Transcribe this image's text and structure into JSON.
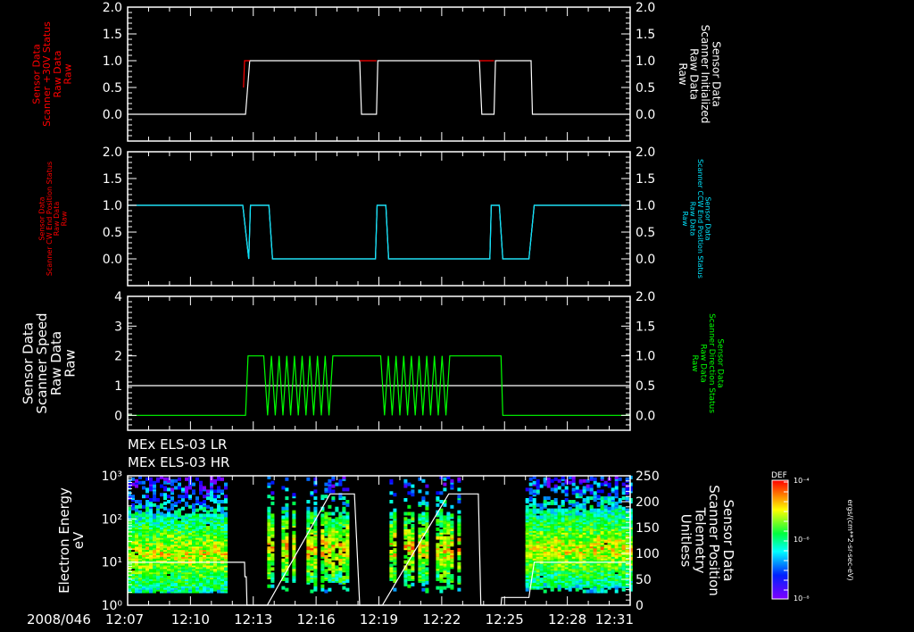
{
  "time_axis": {
    "date_label": "2008/046",
    "ticks": [
      "12:07",
      "12:10",
      "12:13",
      "12:16",
      "12:19",
      "12:22",
      "12:25",
      "12:28",
      "12:31"
    ],
    "range": [
      "12:07:00",
      "12:31:00"
    ]
  },
  "titles": [
    "MEx ELS-03 LR",
    "MEx ELS-03 HR"
  ],
  "colorbar": {
    "title": "DEF",
    "tick_labels": [
      "10⁻⁴",
      "10⁻⁶",
      "10⁻⁸"
    ],
    "unit_label": "ergs/(cm**2-sr-sec-eV)",
    "colormap": "rainbow (violet-blue-cyan-green-yellow-red)"
  },
  "colors": {
    "background": "#000000",
    "axes": "#ffffff",
    "red": "#ff0000",
    "cyan": "#00e5ff",
    "green": "#00ff00",
    "white": "#ffffff"
  },
  "chart_data": [
    {
      "type": "line",
      "left_label": [
        "Sensor Data",
        "Scanner +30V Status",
        "Raw Data",
        "Raw"
      ],
      "left_label_color": "#ff0000",
      "right_label": [
        "Sensor Data",
        "Scanner Initialized",
        "Raw Data",
        "Raw"
      ],
      "right_label_color": "#ffffff",
      "left_axis": {
        "range": [
          -0.5,
          2.0
        ],
        "ticks": [
          "0.0",
          "0.5",
          "1.0",
          "1.5",
          "2.0"
        ]
      },
      "right_axis": {
        "range": [
          -0.5,
          2.0
        ],
        "ticks": [
          "0.0",
          "0.5",
          "1.0",
          "1.5",
          "2.0"
        ]
      },
      "series": [
        {
          "axis": "right",
          "color": "#ffffff",
          "points": [
            [
              "12:07:00",
              0
            ],
            [
              "12:12:38",
              0
            ],
            [
              "12:12:50",
              1
            ],
            [
              "12:18:05",
              1
            ],
            [
              "12:18:10",
              0
            ],
            [
              "12:18:53",
              0
            ],
            [
              "12:18:57",
              1
            ],
            [
              "12:23:48",
              1
            ],
            [
              "12:23:55",
              0
            ],
            [
              "12:24:30",
              0
            ],
            [
              "12:24:34",
              1
            ],
            [
              "12:26:16",
              1
            ],
            [
              "12:26:20",
              0
            ],
            [
              "12:31:00",
              0
            ]
          ]
        },
        {
          "axis": "left",
          "color": "#ff0000",
          "points": [
            [
              "12:12:32",
              0.5
            ],
            [
              "12:12:35",
              1
            ],
            [
              "12:12:50",
              1
            ]
          ]
        },
        {
          "axis": "left",
          "color": "#ff0000",
          "points": [
            [
              "12:18:05",
              1
            ],
            [
              "12:18:53",
              1
            ]
          ]
        },
        {
          "axis": "left",
          "color": "#ff0000",
          "points": [
            [
              "12:23:48",
              1
            ],
            [
              "12:24:30",
              1
            ]
          ]
        }
      ]
    },
    {
      "type": "line",
      "left_label": [
        "Sensor Data",
        "Scanner CW End Position Status",
        "Raw Data",
        "Raw"
      ],
      "left_label_color": "#ff0000",
      "right_label": [
        "Sensor Data",
        "Scanner CCW End Position Status",
        "Raw Data",
        "Raw"
      ],
      "right_label_color": "#00e5ff",
      "left_axis": {
        "range": [
          -0.5,
          2.0
        ],
        "ticks": [
          "0.0",
          "0.5",
          "1.0",
          "1.5",
          "2.0"
        ]
      },
      "right_axis": {
        "range": [
          -0.5,
          2.0
        ],
        "ticks": [
          "0.0",
          "0.5",
          "1.0",
          "1.5",
          "2.0"
        ]
      },
      "series": [
        {
          "axis": "left",
          "color": "#ffffff",
          "points": [
            [
              "12:07:00",
              1
            ],
            [
              "12:12:30",
              1
            ],
            [
              "12:12:47",
              0
            ],
            [
              "12:12:52",
              1
            ],
            [
              "12:13:45",
              1
            ],
            [
              "12:13:55",
              0
            ],
            [
              "12:18:50",
              0
            ],
            [
              "12:18:55",
              1
            ],
            [
              "12:19:20",
              1
            ],
            [
              "12:19:28",
              0
            ],
            [
              "12:24:18",
              0
            ],
            [
              "12:24:22",
              1
            ],
            [
              "12:24:45",
              1
            ],
            [
              "12:24:55",
              0
            ],
            [
              "12:26:10",
              0
            ],
            [
              "12:26:25",
              1
            ],
            [
              "12:31:00",
              1
            ]
          ]
        },
        {
          "axis": "right",
          "color": "#00e5ff",
          "points": [
            [
              "12:07:00",
              1
            ],
            [
              "12:12:30",
              1
            ],
            [
              "12:12:47",
              0
            ],
            [
              "12:12:52",
              1
            ],
            [
              "12:13:45",
              1
            ],
            [
              "12:13:55",
              0
            ],
            [
              "12:18:50",
              0
            ],
            [
              "12:18:55",
              1
            ],
            [
              "12:19:20",
              1
            ],
            [
              "12:19:28",
              0
            ],
            [
              "12:24:18",
              0
            ],
            [
              "12:24:22",
              1
            ],
            [
              "12:24:45",
              1
            ],
            [
              "12:24:55",
              0
            ],
            [
              "12:26:10",
              0
            ],
            [
              "12:26:25",
              1
            ],
            [
              "12:31:00",
              1
            ]
          ]
        }
      ]
    },
    {
      "type": "line",
      "left_label": [
        "Sensor Data",
        "Scanner Speed",
        "Raw Data",
        "Raw"
      ],
      "left_label_color": "#ffffff",
      "right_label": [
        "Sensor Data",
        "Scanner Direction Status",
        "Raw Data",
        "Raw"
      ],
      "right_label_color": "#00ff00",
      "left_axis": {
        "range": [
          -0.5,
          4
        ],
        "ticks": [
          "0",
          "1",
          "2",
          "3",
          "4"
        ]
      },
      "right_axis": {
        "range": [
          -0.25,
          2.0
        ],
        "ticks": [
          "0.0",
          "0.5",
          "1.0",
          "1.5",
          "2.0"
        ]
      },
      "series": [
        {
          "axis": "left",
          "color": "#ffffff",
          "points": [
            [
              "12:07:00",
              1
            ],
            [
              "12:31:00",
              1
            ]
          ]
        },
        {
          "axis": "right",
          "color": "#00ff00",
          "pattern": "toggling",
          "segments": [
            {
              "from": "12:07:00",
              "to": "12:12:38",
              "value": 0
            },
            {
              "from": "12:12:45",
              "to": "12:13:30",
              "value": 1
            },
            {
              "from": "12:13:30",
              "to": "12:16:55",
              "value": "toggle 0/1"
            },
            {
              "from": "12:16:55",
              "to": "12:19:05",
              "value": 1
            },
            {
              "from": "12:19:05",
              "to": "12:22:30",
              "value": "toggle 0/1"
            },
            {
              "from": "12:22:30",
              "to": "12:24:50",
              "value": 1
            },
            {
              "from": "12:24:55",
              "to": "12:31:00",
              "value": 0
            }
          ]
        }
      ]
    },
    {
      "type": "heatmap",
      "left_label": [
        "Electron Energy",
        "eV"
      ],
      "left_label_color": "#ffffff",
      "right_label": [
        "Sensor Data",
        "Scanner Position",
        "Telemetry",
        "Unitless"
      ],
      "right_label_color": "#ffffff",
      "left_axis": {
        "scale": "log",
        "range": [
          1,
          1000
        ],
        "ticks": [
          "10⁰",
          "10¹",
          "10²",
          "10³"
        ]
      },
      "right_axis": {
        "range": [
          0,
          250
        ],
        "ticks": [
          "0",
          "50",
          "100",
          "150",
          "200",
          "250"
        ]
      },
      "spectrogram_active_intervals": [
        {
          "from": "12:07:00",
          "to": "12:11:40",
          "density": "dense",
          "peak_energy_eV": 15
        },
        {
          "from": "12:13:40",
          "to": "12:17:30",
          "density": "sparse",
          "peak_energy_eV": 20
        },
        {
          "from": "12:19:10",
          "to": "12:22:50",
          "density": "sparse",
          "peak_energy_eV": 20
        },
        {
          "from": "12:26:00",
          "to": "12:31:00",
          "density": "dense",
          "peak_energy_eV": 20
        }
      ],
      "series": [
        {
          "axis": "right",
          "color": "#ffffff",
          "name": "",
          "points": [
            [
              "12:07:00",
              83
            ],
            [
              "12:12:35",
              83
            ],
            [
              "12:12:36",
              55
            ],
            [
              "12:12:40",
              55
            ],
            [
              "12:12:42",
              0
            ],
            [
              "12:13:40",
              0
            ],
            [
              "12:16:40",
              215
            ],
            [
              "12:17:50",
              215
            ],
            [
              "12:18:05",
              0
            ],
            [
              "12:19:10",
              0
            ],
            [
              "12:22:20",
              215
            ],
            [
              "12:23:45",
              215
            ],
            [
              "12:23:52",
              0
            ],
            [
              "12:24:50",
              0
            ],
            [
              "12:24:52",
              15
            ],
            [
              "12:26:10",
              15
            ],
            [
              "12:26:25",
              83
            ],
            [
              "12:31:00",
              83
            ]
          ]
        }
      ]
    }
  ]
}
